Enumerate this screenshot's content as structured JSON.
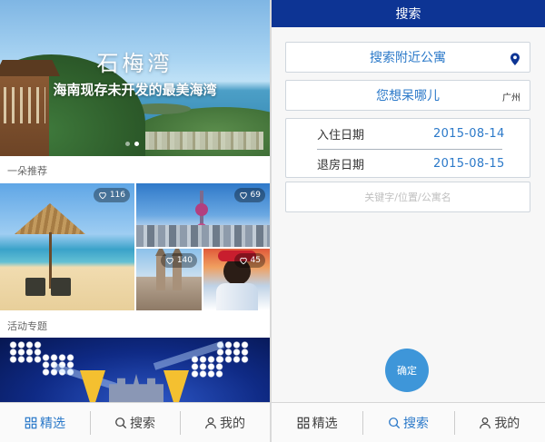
{
  "featured": {
    "banner": {
      "title": "石梅湾",
      "subtitle": "海南现存未开发的最美海湾",
      "slide_count": 2,
      "active_slide": 2
    },
    "recommend_label": "一朵推荐",
    "tiles": [
      {
        "name": "beach",
        "likes": "116"
      },
      {
        "name": "city",
        "likes": "69"
      },
      {
        "name": "church",
        "likes": "140"
      },
      {
        "name": "girl",
        "likes": "45"
      }
    ],
    "event_label": "活动专题"
  },
  "search": {
    "title": "搜索",
    "nearby_label": "搜索附近公寓",
    "destination_label": "您想呆哪儿",
    "city": "广州",
    "checkin_label": "入住日期",
    "checkin_value": "2015-08-14",
    "checkout_label": "退房日期",
    "checkout_value": "2015-08-15",
    "keyword_placeholder": "关键字/位置/公寓名",
    "confirm_label": "确定"
  },
  "nav": {
    "items": [
      {
        "label": "精选",
        "icon": "grid-icon"
      },
      {
        "label": "搜索",
        "icon": "search-icon"
      },
      {
        "label": "我的",
        "icon": "user-icon"
      }
    ],
    "left_active": 0,
    "right_active": 1
  },
  "colors": {
    "accent": "#2b79c9",
    "topbar": "#0d3494",
    "confirm": "#3e96d9"
  }
}
